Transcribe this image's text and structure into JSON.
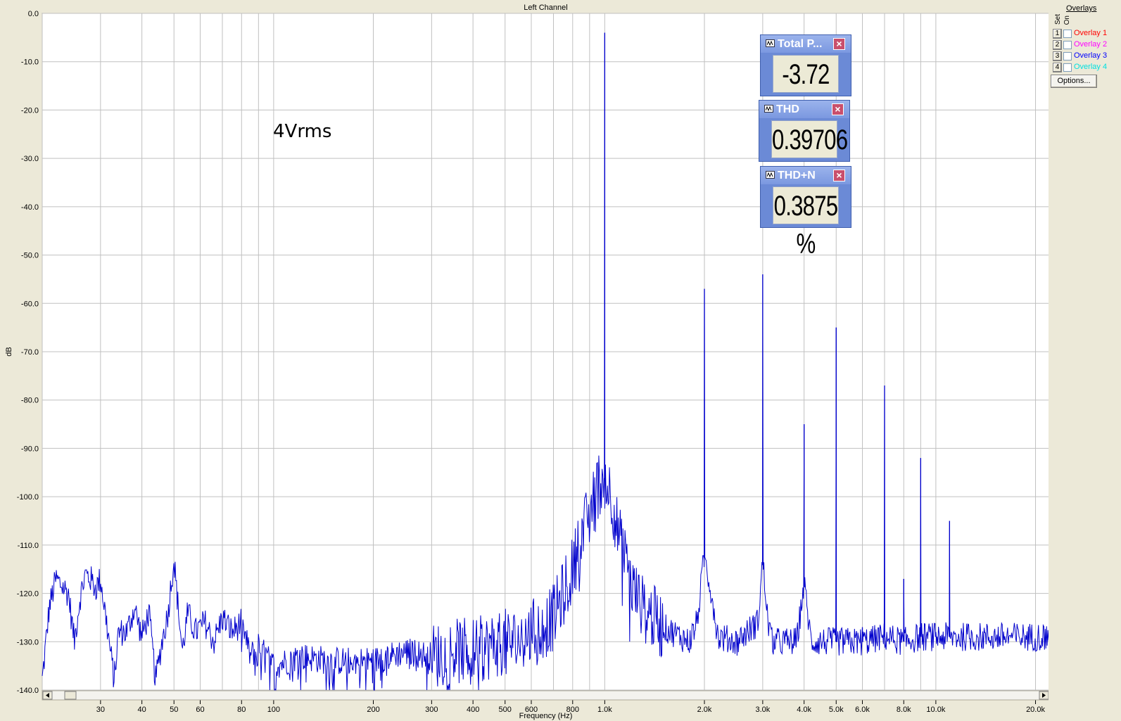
{
  "window": {
    "title": "Left Channel"
  },
  "annotation": "4Vrms",
  "meters": [
    {
      "name": "Total P...",
      "value": "-3.72 dB"
    },
    {
      "name": "THD",
      "value": "0.39706 %"
    },
    {
      "name": "THD+N",
      "value": "0.3875 %"
    }
  ],
  "overlays": {
    "title": "Overlays",
    "set_label": "Set",
    "on_label": "On",
    "items": [
      {
        "set": "1",
        "label": "Overlay 1",
        "color": "#ff0000"
      },
      {
        "set": "2",
        "label": "Overlay 2",
        "color": "#ff00ff"
      },
      {
        "set": "3",
        "label": "Overlay 3",
        "color": "#0000ff"
      },
      {
        "set": "4",
        "label": "Overlay 4",
        "color": "#00e0e0"
      }
    ],
    "options_label": "Options..."
  },
  "chart_data": {
    "type": "line",
    "title": "Left Channel",
    "xlabel": "Frequency (Hz)",
    "ylabel": "dB",
    "x_scale": "log",
    "xlim": [
      20,
      22000
    ],
    "ylim": [
      -140,
      0
    ],
    "grid": true,
    "y_ticks": [
      0,
      -10,
      -20,
      -30,
      -40,
      -50,
      -60,
      -70,
      -80,
      -90,
      -100,
      -110,
      -120,
      -130,
      -140
    ],
    "y_tick_labels": [
      "0.0",
      "-10.0",
      "-20.0",
      "-30.0",
      "-40.0",
      "-50.0",
      "-60.0",
      "-70.0",
      "-80.0",
      "-90.0",
      "-100.0",
      "-110.0",
      "-120.0",
      "-130.0",
      "-140.0"
    ],
    "x_ticks": [
      30,
      40,
      50,
      60,
      80,
      100,
      200,
      300,
      400,
      500,
      600,
      800,
      1000,
      2000,
      3000,
      4000,
      5000,
      6000,
      8000,
      10000,
      20000
    ],
    "x_tick_labels": [
      "30",
      "40",
      "50",
      "60",
      "80",
      "100",
      "200",
      "300",
      "400",
      "500",
      "600",
      "800",
      "1.0k",
      "2.0k",
      "3.0k",
      "4.0k",
      "5.0k",
      "6.0k",
      "8.0k",
      "10.0k",
      "20.0k"
    ],
    "line_color": "#0000cc",
    "series": [
      {
        "noise_floor": [
          [
            20,
            -138
          ],
          [
            21,
            -123
          ],
          [
            22,
            -117
          ],
          [
            24,
            -120
          ],
          [
            25,
            -130
          ],
          [
            26,
            -121
          ],
          [
            27,
            -116
          ],
          [
            28,
            -117
          ],
          [
            29,
            -119
          ],
          [
            30,
            -117
          ],
          [
            31,
            -124
          ],
          [
            33,
            -138
          ],
          [
            34,
            -128
          ],
          [
            36,
            -128
          ],
          [
            38,
            -123
          ],
          [
            40,
            -129
          ],
          [
            42,
            -124
          ],
          [
            44,
            -138
          ],
          [
            46,
            -130
          ],
          [
            48,
            -124
          ],
          [
            49,
            -118
          ],
          [
            50,
            -113
          ],
          [
            51,
            -120
          ],
          [
            53,
            -132
          ],
          [
            55,
            -124
          ],
          [
            58,
            -128
          ],
          [
            62,
            -126
          ],
          [
            66,
            -130
          ],
          [
            70,
            -125
          ],
          [
            75,
            -128
          ],
          [
            80,
            -126
          ],
          [
            85,
            -133
          ],
          [
            90,
            -131
          ],
          [
            100,
            -135
          ],
          [
            120,
            -133
          ],
          [
            150,
            -134
          ],
          [
            200,
            -134
          ],
          [
            250,
            -132
          ],
          [
            300,
            -133
          ],
          [
            350,
            -132
          ],
          [
            400,
            -132
          ],
          [
            450,
            -131
          ],
          [
            500,
            -130
          ],
          [
            550,
            -130
          ],
          [
            600,
            -128
          ],
          [
            650,
            -127
          ],
          [
            700,
            -125
          ],
          [
            750,
            -120
          ],
          [
            800,
            -115
          ],
          [
            850,
            -108
          ],
          [
            900,
            -104
          ],
          [
            950,
            -98
          ],
          [
            1000,
            -96
          ],
          [
            1050,
            -100
          ],
          [
            1100,
            -108
          ],
          [
            1150,
            -113
          ],
          [
            1200,
            -118
          ],
          [
            1300,
            -123
          ],
          [
            1400,
            -125
          ],
          [
            1500,
            -127
          ],
          [
            1600,
            -128
          ],
          [
            1700,
            -129
          ],
          [
            1800,
            -130
          ],
          [
            1900,
            -126
          ],
          [
            2000,
            -112
          ],
          [
            2100,
            -120
          ],
          [
            2200,
            -129
          ],
          [
            2500,
            -130
          ],
          [
            2900,
            -126
          ],
          [
            3000,
            -113
          ],
          [
            3100,
            -125
          ],
          [
            3200,
            -130
          ],
          [
            3800,
            -130
          ],
          [
            4000,
            -118
          ],
          [
            4200,
            -130
          ],
          [
            5000,
            -130
          ],
          [
            6000,
            -130
          ],
          [
            7000,
            -129
          ],
          [
            8000,
            -130
          ],
          [
            9000,
            -129
          ],
          [
            10000,
            -129
          ],
          [
            12000,
            -129
          ],
          [
            15000,
            -129
          ],
          [
            18000,
            -129
          ],
          [
            22000,
            -129
          ]
        ]
      }
    ],
    "peaks": [
      {
        "x": 1000,
        "y": -4
      },
      {
        "x": 2000,
        "y": -57
      },
      {
        "x": 3000,
        "y": -54
      },
      {
        "x": 4000,
        "y": -85
      },
      {
        "x": 5000,
        "y": -65
      },
      {
        "x": 6000,
        "y": -127
      },
      {
        "x": 7000,
        "y": -77
      },
      {
        "x": 8000,
        "y": -117
      },
      {
        "x": 9000,
        "y": -92
      },
      {
        "x": 10000,
        "y": -128
      },
      {
        "x": 11000,
        "y": -105
      }
    ]
  }
}
